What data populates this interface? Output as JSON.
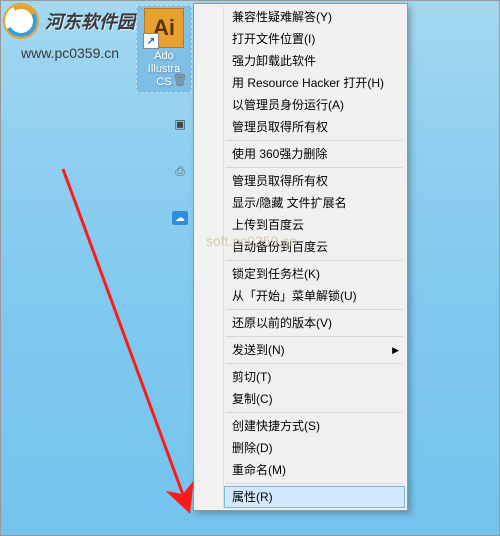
{
  "branding": {
    "logo_text": "河东软件园",
    "site_url": "www.pc0359.cn"
  },
  "desktop_icon": {
    "badge": "Ai",
    "label_line1": "Ado",
    "label_line2": "Illustra",
    "label_line3": "CS"
  },
  "context_menu": {
    "items": [
      {
        "label": "兼容性疑难解答(Y)",
        "sep": false,
        "arrow": false
      },
      {
        "label": "打开文件位置(I)",
        "sep": false,
        "arrow": false
      },
      {
        "label": "强力卸载此软件",
        "sep": false,
        "arrow": false
      },
      {
        "label": "用 Resource Hacker 打开(H)",
        "sep": false,
        "arrow": false
      },
      {
        "label": "以管理员身份运行(A)",
        "sep": false,
        "arrow": false
      },
      {
        "label": "管理员取得所有权",
        "sep": false,
        "arrow": false
      },
      {
        "sep": true
      },
      {
        "label": "使用 360强力删除",
        "sep": false,
        "arrow": false
      },
      {
        "sep": true
      },
      {
        "label": "管理员取得所有权",
        "sep": false,
        "arrow": false
      },
      {
        "label": "显示/隐藏 文件扩展名",
        "sep": false,
        "arrow": false
      },
      {
        "label": "上传到百度云",
        "sep": false,
        "arrow": false
      },
      {
        "label": "自动备份到百度云",
        "sep": false,
        "arrow": false
      },
      {
        "sep": true
      },
      {
        "label": "锁定到任务栏(K)",
        "sep": false,
        "arrow": false
      },
      {
        "label": "从「开始」菜单解锁(U)",
        "sep": false,
        "arrow": false
      },
      {
        "sep": true
      },
      {
        "label": "还原以前的版本(V)",
        "sep": false,
        "arrow": false
      },
      {
        "sep": true
      },
      {
        "label": "发送到(N)",
        "sep": false,
        "arrow": true
      },
      {
        "sep": true
      },
      {
        "label": "剪切(T)",
        "sep": false,
        "arrow": false
      },
      {
        "label": "复制(C)",
        "sep": false,
        "arrow": false
      },
      {
        "sep": true
      },
      {
        "label": "创建快捷方式(S)",
        "sep": false,
        "arrow": false
      },
      {
        "label": "删除(D)",
        "sep": false,
        "arrow": false
      },
      {
        "label": "重命名(M)",
        "sep": false,
        "arrow": false
      },
      {
        "sep": true
      },
      {
        "label": "属性(R)",
        "sep": false,
        "arrow": false,
        "highlight": true
      }
    ]
  },
  "watermark": "soft.pc0359.cn",
  "submenu_arrow_glyph": "▶"
}
